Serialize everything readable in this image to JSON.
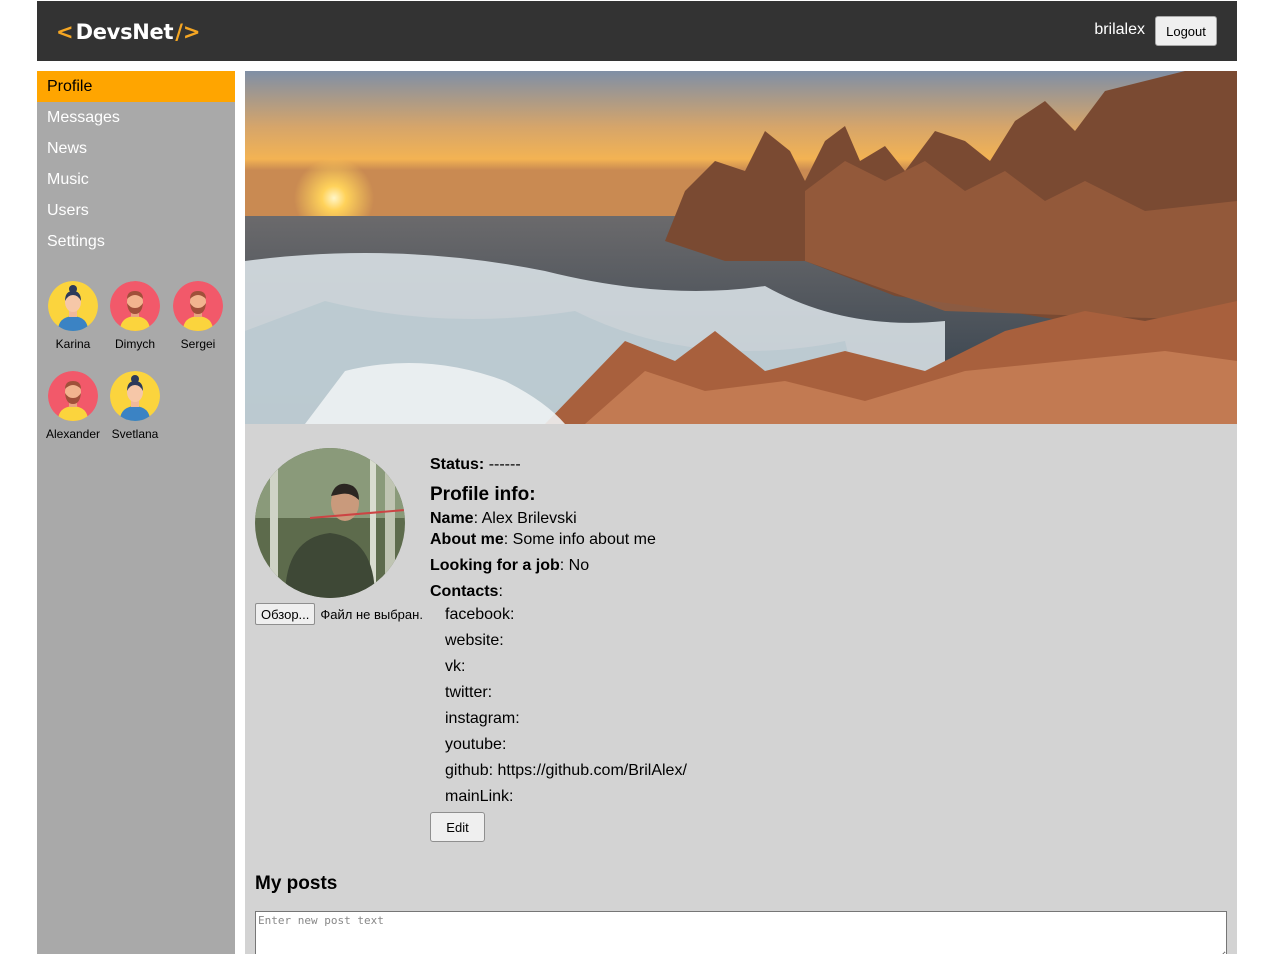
{
  "header": {
    "logo_left": "<",
    "logo_text": "DevsNet",
    "logo_right": "/>",
    "username": "brilalex",
    "logout_label": "Logout"
  },
  "sidebar": {
    "items": [
      {
        "label": "Profile",
        "active": true
      },
      {
        "label": "Messages"
      },
      {
        "label": "News"
      },
      {
        "label": "Music"
      },
      {
        "label": "Users"
      },
      {
        "label": "Settings"
      }
    ],
    "friends": [
      {
        "name": "Karina",
        "avatar": "female-avatar-icon"
      },
      {
        "name": "Dimych",
        "avatar": "male-bearded-avatar-icon"
      },
      {
        "name": "Sergei",
        "avatar": "male-bearded-avatar-icon"
      },
      {
        "name": "Alexander",
        "avatar": "male-bearded-avatar-icon"
      },
      {
        "name": "Svetlana",
        "avatar": "female-avatar-icon"
      }
    ]
  },
  "profile": {
    "file_button": "Обзор...",
    "file_status": "Файл не выбран.",
    "status_label": "Status:",
    "status_value": "------",
    "info_title": "Profile info:",
    "name_label": "Name",
    "name_value": ": Alex Brilevski",
    "about_label": "About me",
    "about_value": ": Some info about me",
    "job_label": "Looking for a job",
    "job_value": ": No",
    "contacts_label": "Contacts",
    "contacts_colon": ":",
    "contacts": [
      "facebook:",
      "website:",
      "vk:",
      "twitter:",
      "instagram:",
      "youtube:",
      "github: https://github.com/BrilAlex/",
      "mainLink:"
    ],
    "edit_label": "Edit"
  },
  "posts": {
    "title": "My posts",
    "placeholder": "Enter new post text"
  },
  "colors": {
    "header_bg": "#333333",
    "sidebar_bg": "#a9a9a9",
    "active_item": "#ffa500",
    "content_bg": "#d3d3d3",
    "logo_accent": "#f5a623"
  }
}
